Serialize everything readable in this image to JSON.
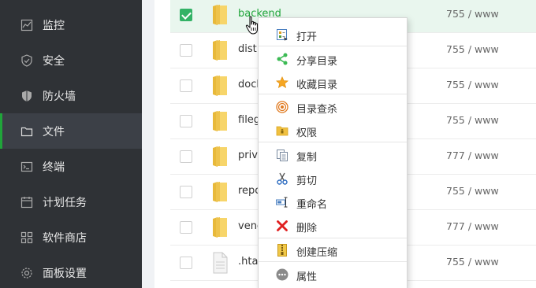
{
  "sidebar": {
    "items": [
      {
        "label": "监控",
        "icon": "monitor-icon"
      },
      {
        "label": "安全",
        "icon": "shield-icon"
      },
      {
        "label": "防火墙",
        "icon": "firewall-icon"
      },
      {
        "label": "文件",
        "icon": "folder-icon",
        "active": true
      },
      {
        "label": "终端",
        "icon": "terminal-icon"
      },
      {
        "label": "计划任务",
        "icon": "calendar-icon"
      },
      {
        "label": "软件商店",
        "icon": "grid-icon"
      },
      {
        "label": "面板设置",
        "icon": "gear-icon"
      }
    ],
    "active_color": "#20a53a"
  },
  "files": {
    "rows": [
      {
        "name": "backend",
        "perm": "755 / www",
        "checked": true,
        "type": "folder"
      },
      {
        "name": "dist",
        "perm": "755 / www",
        "checked": false,
        "type": "folder"
      },
      {
        "name": "dock",
        "perm": "755 / www",
        "checked": false,
        "type": "folder"
      },
      {
        "name": "fileg",
        "perm": "755 / www",
        "checked": false,
        "type": "folder"
      },
      {
        "name": "priva",
        "perm": "777 / www",
        "checked": false,
        "type": "folder"
      },
      {
        "name": "repo",
        "perm": "755 / www",
        "checked": false,
        "type": "folder"
      },
      {
        "name": "venc",
        "perm": "777 / www",
        "checked": false,
        "type": "folder"
      },
      {
        "name": ".htac",
        "perm": "755 / www",
        "checked": false,
        "type": "file"
      }
    ]
  },
  "context_menu": {
    "items": [
      {
        "label": "打开",
        "icon": "open-icon"
      },
      {
        "label": "分享目录",
        "icon": "share-icon"
      },
      {
        "label": "收藏目录",
        "icon": "star-icon"
      },
      {
        "label": "目录查杀",
        "icon": "scan-target-icon"
      },
      {
        "label": "权限",
        "icon": "lock-folder-icon"
      },
      {
        "label": "复制",
        "icon": "copy-icon"
      },
      {
        "label": "剪切",
        "icon": "scissors-icon"
      },
      {
        "label": "重命名",
        "icon": "rename-icon"
      },
      {
        "label": "删除",
        "icon": "delete-icon"
      },
      {
        "label": "创建压缩",
        "icon": "zip-icon"
      },
      {
        "label": "属性",
        "icon": "more-icon"
      }
    ]
  }
}
